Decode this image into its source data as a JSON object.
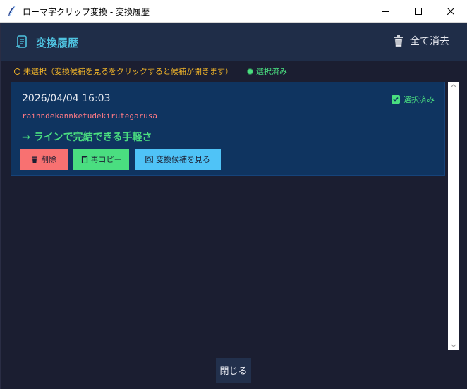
{
  "window": {
    "title": "ローマ字クリップ変換 - 変換履歴",
    "minimize": "—",
    "maximize": "☐",
    "close": "✕"
  },
  "header": {
    "title": "変換履歴",
    "title_icon": "scroll-icon",
    "clear_all_label": "全て消去",
    "clear_icon": "trash-icon"
  },
  "legend": {
    "unselected": "未選択（変換候補を見るをクリックすると候補が開きます）",
    "selected": "選択済み"
  },
  "entries": [
    {
      "timestamp": "2026/04/04 16:03",
      "selected_label": "選択済み",
      "romaji": "rainndekannketudekirutegarusa",
      "result": "→ ラインで完結できる手軽さ",
      "delete_label": "削除",
      "copy_label": "再コピー",
      "candidates_label": "変換候補を見る"
    }
  ],
  "close_label": "閉じる",
  "colors": {
    "background": "#1b1e31",
    "header": "#1f2d48",
    "card": "#0f3460",
    "accent": "#4fc3e0",
    "selected_green": "#4ade80",
    "romaji_pink": "#ff7a85",
    "legend_orange": "#f0b429",
    "delete_red": "#f87171",
    "candidates_blue": "#4fc3f7"
  }
}
